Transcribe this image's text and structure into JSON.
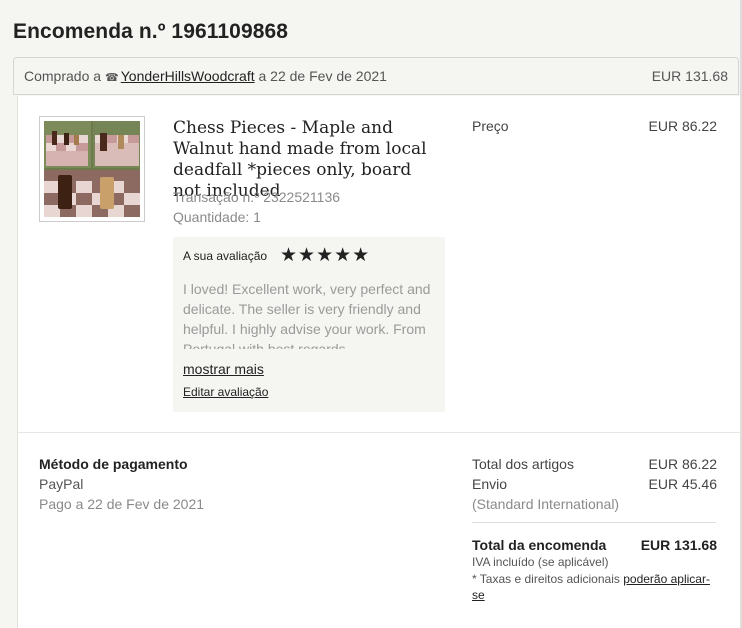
{
  "order": {
    "title": "Encomenda n.º 1961109868",
    "bought_prefix": "Comprado a",
    "shop_icon": "shop-icon",
    "shop_name": "YonderHillsWoodcraft",
    "bought_date": "a 22 de Fev de 2021",
    "total": "EUR 131.68"
  },
  "item": {
    "thumbnail_icon": "chess-pieces-photo",
    "title": "Chess Pieces - Maple and Walnut hand made from local deadfall *pieces only, board not included",
    "transaction": "Transação n.º 2322521136",
    "quantity": "Quantidade: 1",
    "price_label": "Preço",
    "price": "EUR 86.22"
  },
  "review": {
    "label": "A sua avaliação",
    "stars": "★★★★★",
    "rating": 5,
    "text": "I loved! Excellent work, very perfect and delicate. The seller is very friendly and helpful. I highly advise your work. From Portugal with best regards",
    "more_link": "mostrar mais",
    "edit_link": "Editar avaliação"
  },
  "payment": {
    "title": "Método de pagamento",
    "method": "PayPal",
    "paid_date": "Pago a 22 de Fev de 2021"
  },
  "summary": {
    "items_label": "Total dos artigos",
    "items_value": "EUR 86.22",
    "shipping_label": "Envio",
    "shipping_value": "EUR 45.46",
    "shipping_method": "(Standard International)",
    "total_label": "Total da encomenda",
    "total_value": "EUR 131.68",
    "vat_note": "IVA incluído (se aplicável)",
    "taxes_prefix": "* Taxas e direitos adicionais",
    "taxes_link": "poderão aplicar-se"
  }
}
